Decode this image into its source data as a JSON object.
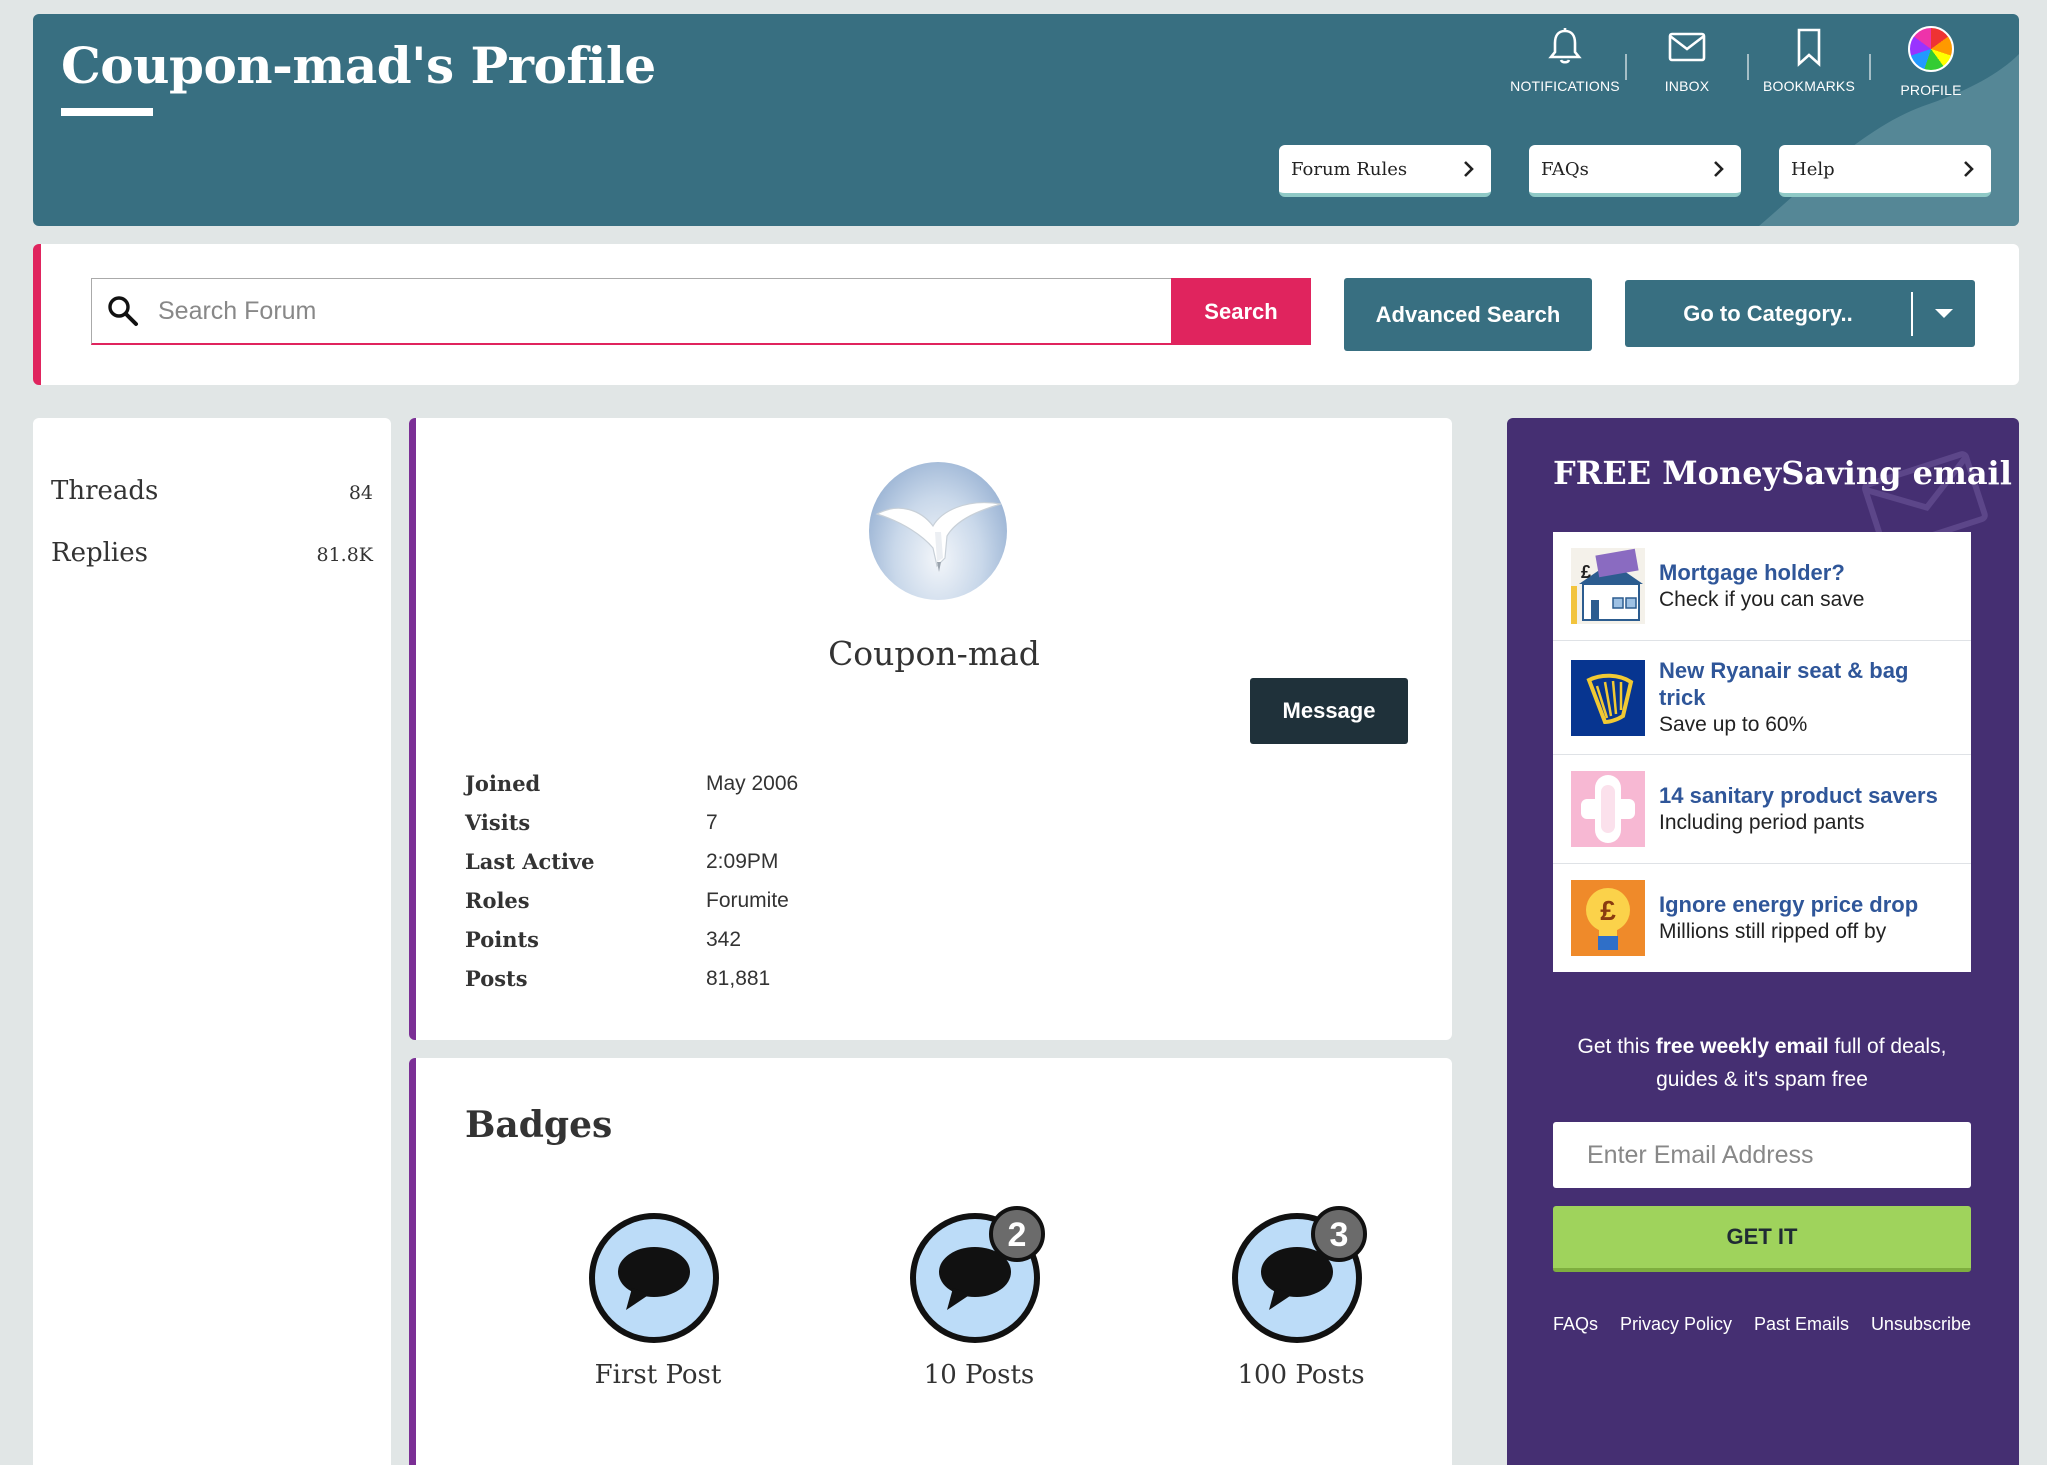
{
  "header": {
    "title": "Coupon-mad's Profile",
    "nav": [
      {
        "label": "NOTIFICATIONS",
        "icon": "bell-icon"
      },
      {
        "label": "INBOX",
        "icon": "envelope-icon"
      },
      {
        "label": "BOOKMARKS",
        "icon": "bookmark-icon"
      },
      {
        "label": "PROFILE",
        "icon": "avatar"
      }
    ],
    "quick_links": [
      "Forum Rules",
      "FAQs",
      "Help"
    ]
  },
  "search": {
    "placeholder": "Search Forum",
    "button": "Search",
    "advanced": "Advanced Search",
    "category": "Go to Category.."
  },
  "stats": [
    {
      "label": "Threads",
      "value": "84"
    },
    {
      "label": "Replies",
      "value": "81.8K"
    }
  ],
  "profile": {
    "username": "Coupon-mad",
    "message_button": "Message",
    "info": [
      {
        "key": "Joined",
        "value": "May 2006"
      },
      {
        "key": "Visits",
        "value": "7"
      },
      {
        "key": "Last Active",
        "value": "2:09PM"
      },
      {
        "key": "Roles",
        "value": "Forumite"
      },
      {
        "key": "Points",
        "value": "342"
      },
      {
        "key": "Posts",
        "value": "81,881"
      }
    ]
  },
  "badges": {
    "title": "Badges",
    "items": [
      {
        "label": "First Post",
        "count": ""
      },
      {
        "label": "10 Posts",
        "count": "2"
      },
      {
        "label": "100 Posts",
        "count": "3"
      }
    ]
  },
  "newsletter": {
    "title": "FREE MoneySaving email",
    "items": [
      {
        "head": "Mortgage holder?",
        "sub": "Check if you can save",
        "icon": "house-money-icon"
      },
      {
        "head": "New Ryanair seat & bag trick",
        "sub": "Save up to 60%",
        "icon": "ryanair-harp-icon"
      },
      {
        "head": "14 sanitary product savers",
        "sub": "Including period pants",
        "icon": "sanitary-pad-icon"
      },
      {
        "head": "Ignore energy price drop",
        "sub": "Millions still ripped off by",
        "icon": "lightbulb-pound-icon"
      }
    ],
    "pitch_prefix": "Get this ",
    "pitch_bold": "free weekly email",
    "pitch_suffix": " full of deals, guides & it's spam free",
    "email_placeholder": "Enter Email Address",
    "cta": "GET IT",
    "footer_links": [
      "FAQs",
      "Privacy Policy",
      "Past Emails",
      "Unsubscribe"
    ]
  },
  "colors": {
    "header_bg": "#386f81",
    "accent_pink": "#e0245e",
    "purple": "#452f72",
    "card_border": "#7b2f95",
    "cta_green": "#9fd35c",
    "link_blue": "#2f5699"
  }
}
